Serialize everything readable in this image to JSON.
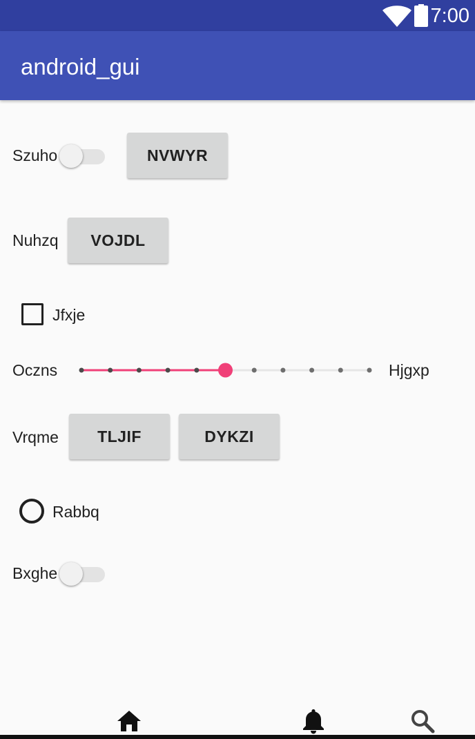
{
  "status_bar": {
    "time": "7:00",
    "wifi_icon": "wifi-icon",
    "battery_icon": "battery-icon"
  },
  "app_bar": {
    "title": "android_gui"
  },
  "rows": {
    "szuho": {
      "label": "Szuho",
      "switch_state": "off",
      "button_label": "NVWYR"
    },
    "nuhzq": {
      "label": "Nuhzq",
      "button_label": "VOJDL"
    },
    "jfxje": {
      "label": "Jfxje",
      "checked": false
    },
    "slider": {
      "left_label": "Oczns",
      "right_label": "Hjgxp",
      "min": 0,
      "max": 10,
      "value": 5,
      "accent": "#f04078"
    },
    "vrqme": {
      "label": "Vrqme",
      "button1_label": "TLJIF",
      "button2_label": "DYKZI"
    },
    "rabbq": {
      "label": "Rabbq",
      "selected": false
    },
    "bxghe": {
      "label": "Bxghe",
      "switch_state": "off"
    }
  },
  "bottom_nav": {
    "items": [
      "home-icon",
      "bell-icon",
      "search-icon"
    ]
  },
  "colors": {
    "status_bar": "#303f9f",
    "app_bar": "#3f51b5",
    "background": "#fafafa",
    "button": "#d6d7d7",
    "accent": "#f04078"
  }
}
